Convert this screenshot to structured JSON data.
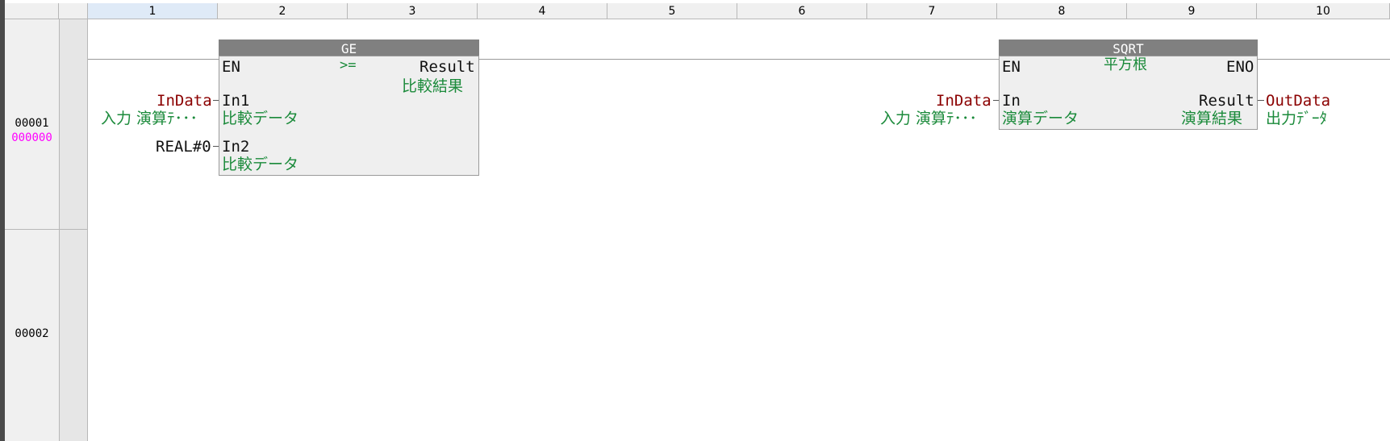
{
  "columns": [
    "1",
    "2",
    "3",
    "4",
    "5",
    "6",
    "7",
    "8",
    "9",
    "10"
  ],
  "rows": [
    {
      "number": "00001",
      "step": "000000"
    },
    {
      "number": "00002",
      "step": ""
    }
  ],
  "blocks": {
    "ge": {
      "title": "GE",
      "symbol": ">=",
      "en": "EN",
      "result": "Result",
      "result_comment": "比較結果",
      "in1": "In1",
      "in1_comment": "比較データ",
      "in2": "In2",
      "in2_comment": "比較データ",
      "in1_var": "InData",
      "in1_var_comment": "入力 演算ﾃ･･･",
      "in2_const": "REAL#0"
    },
    "sqrt": {
      "title": "SQRT",
      "comment": "平方根",
      "en": "EN",
      "eno": "ENO",
      "in": "In",
      "in_comment": "演算データ",
      "result": "Result",
      "result_comment": "演算結果",
      "in_var": "InData",
      "in_var_comment": "入力 演算ﾃ･･･",
      "out_var": "OutData",
      "out_var_comment": "出力ﾃﾞｰﾀ"
    }
  },
  "colors": {
    "variable": "#8b0000",
    "comment": "#1a8a3a",
    "step": "#ff00ff",
    "header_bg": "#f0f0f0",
    "selected_header_bg": "#dfeaf7",
    "block_title_bg": "#808080"
  }
}
